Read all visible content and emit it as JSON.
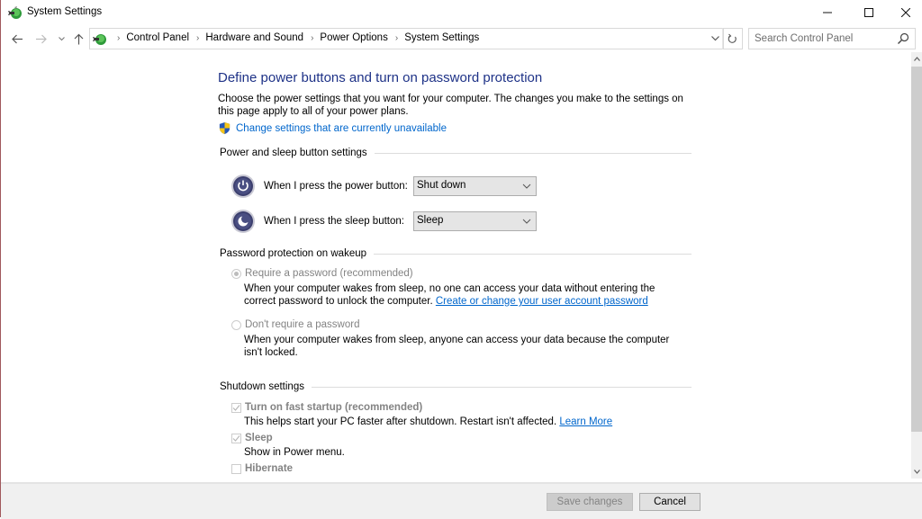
{
  "window": {
    "title": "System Settings",
    "controls": {
      "minimize": "minimize",
      "maximize": "maximize",
      "close": "close"
    }
  },
  "nav": {
    "breadcrumbs": [
      "Control Panel",
      "Hardware and Sound",
      "Power Options",
      "System Settings"
    ],
    "search_placeholder": "Search Control Panel"
  },
  "page": {
    "title": "Define power buttons and turn on password protection",
    "description": "Choose the power settings that you want for your computer. The changes you make to the settings on this page apply to all of your power plans.",
    "admin_link": "Change settings that are currently unavailable"
  },
  "power_section": {
    "heading": "Power and sleep button settings",
    "rows": [
      {
        "label": "When I press the power button:",
        "value": "Shut down",
        "icon": "power-icon"
      },
      {
        "label": "When I press the sleep button:",
        "value": "Sleep",
        "icon": "sleep-moon-icon"
      }
    ]
  },
  "password_section": {
    "heading": "Password protection on wakeup",
    "options": [
      {
        "label": "Require a password (recommended)",
        "selected": true,
        "description": "When your computer wakes from sleep, no one can access your data without entering the correct password to unlock the computer.",
        "link": "Create or change your user account password"
      },
      {
        "label": "Don't require a password",
        "selected": false,
        "description": "When your computer wakes from sleep, anyone can access your data because the computer isn't locked."
      }
    ]
  },
  "shutdown_section": {
    "heading": "Shutdown settings",
    "options": [
      {
        "label": "Turn on fast startup (recommended)",
        "checked": true,
        "description": "This helps start your PC faster after shutdown. Restart isn't affected.",
        "link": "Learn More"
      },
      {
        "label": "Sleep",
        "checked": true,
        "description": "Show in Power menu."
      },
      {
        "label": "Hibernate",
        "checked": false
      }
    ]
  },
  "footer": {
    "save_label": "Save changes",
    "cancel_label": "Cancel"
  },
  "colors": {
    "title_blue": "#1e3287",
    "link_blue": "#0066cc",
    "disabled_gray": "#838383"
  }
}
